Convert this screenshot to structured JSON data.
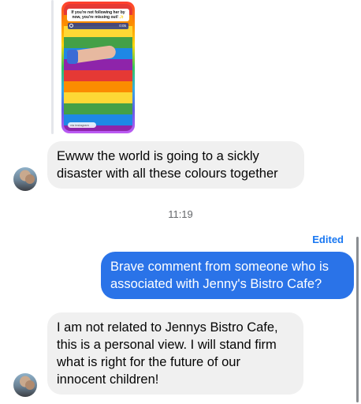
{
  "shared_post": {
    "caption": "If you're not following her by now, you're missing out! ✨",
    "time": "0:05",
    "footer": "via instagram"
  },
  "messages": [
    {
      "id": "msg1",
      "direction": "incoming",
      "lines": [
        "Ewww the world is going to a sickly",
        "disaster with all these colours together"
      ]
    },
    {
      "id": "msg2",
      "direction": "outgoing",
      "lines": [
        "Brave comment from someone who is",
        "associated with Jenny's Bistro Cafe?"
      ]
    },
    {
      "id": "msg3",
      "direction": "incoming",
      "lines": [
        "I am not related to Jennys Bistro Cafe,",
        "this is a personal view. I will stand firm",
        "what is right for the future of our",
        "innocent children!"
      ]
    }
  ],
  "timestamp": "11:19",
  "edited_label": "Edited",
  "colors": {
    "incoming_bubble": "#f0f0f0",
    "outgoing_bubble": "#2a73e8",
    "edited_link": "#1877f2",
    "timestamp_text": "#65676b"
  },
  "icons": [
    "avatar",
    "instagram-ring-icon"
  ]
}
